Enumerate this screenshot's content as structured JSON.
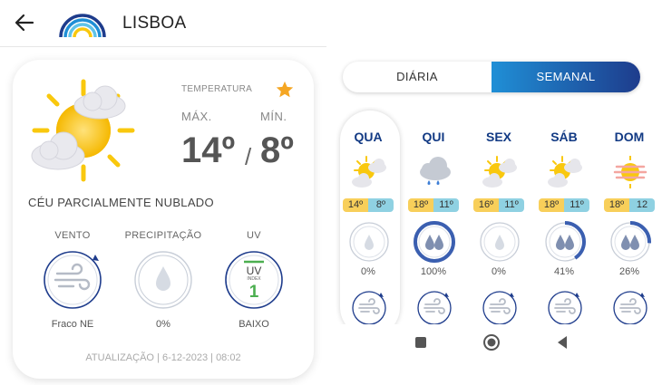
{
  "header": {
    "city": "LISBOA"
  },
  "today": {
    "temperature_label": "TEMPERATURA",
    "max_label": "MÁX.",
    "min_label": "MÍN.",
    "max_value": "14º",
    "min_value": "8º",
    "separator": "/",
    "condition": "CÉU PARCIALMENTE NUBLADO",
    "metrics": {
      "wind": {
        "label": "VENTO",
        "value": "Fraco NE"
      },
      "precipitation": {
        "label": "PRECIPITAÇÃO",
        "value": "0%",
        "level": 0
      },
      "uv": {
        "label": "UV",
        "dial_title": "UV",
        "dial_sub": "INDEX",
        "dial_value": "1",
        "value": "BAIXO"
      }
    },
    "updated": "ATUALIZAÇÃO | 6-12-2023 | 08:02"
  },
  "tabs": {
    "daily": "DIÁRIA",
    "weekly": "SEMANAL",
    "active": "weekly"
  },
  "week": [
    {
      "day": "QUA",
      "icon": "partly-cloudy-icon",
      "max": "14º",
      "min": "8º",
      "precip": "0%",
      "level": 0.0
    },
    {
      "day": "QUI",
      "icon": "rain-cloud-icon",
      "max": "18º",
      "min": "11º",
      "precip": "100%",
      "level": 1.0
    },
    {
      "day": "SEX",
      "icon": "partly-cloudy-icon",
      "max": "16º",
      "min": "11º",
      "precip": "0%",
      "level": 0.0
    },
    {
      "day": "SÁB",
      "icon": "partly-cloudy-icon",
      "max": "18º",
      "min": "11º",
      "precip": "41%",
      "level": 0.41
    },
    {
      "day": "DOM",
      "icon": "haze-sun-icon",
      "max": "18º",
      "min": "12",
      "precip": "26%",
      "level": 0.26
    }
  ],
  "colors": {
    "accent_dark": "#1e3c8c",
    "accent_light": "#1f8fd6",
    "sun": "#f9c80e",
    "temp_max": "#f8cf5a",
    "temp_min": "#8fd1e2"
  }
}
